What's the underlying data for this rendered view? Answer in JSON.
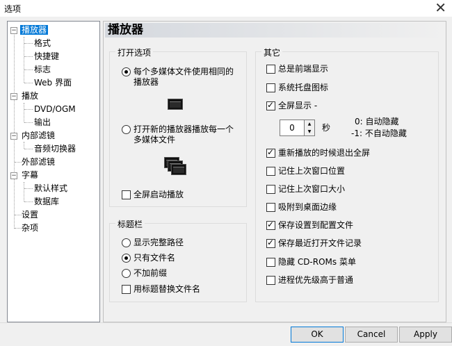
{
  "window": {
    "title": "选项",
    "close_glyph": "✕"
  },
  "tree": {
    "items": [
      {
        "label": "播放器"
      },
      {
        "label": "格式"
      },
      {
        "label": "快捷键"
      },
      {
        "label": "标志"
      },
      {
        "label": "Web 界面"
      },
      {
        "label": "播放"
      },
      {
        "label": "DVD/OGM"
      },
      {
        "label": "输出"
      },
      {
        "label": "内部滤镜"
      },
      {
        "label": "音频切换器"
      },
      {
        "label": "外部滤镜"
      },
      {
        "label": "字幕"
      },
      {
        "label": "默认样式"
      },
      {
        "label": "数据库"
      },
      {
        "label": "设置"
      },
      {
        "label": "杂项"
      }
    ]
  },
  "page": {
    "header": "播放器"
  },
  "open_options": {
    "title": "打开选项",
    "same_player": "每个多媒体文件使用相同的播放器",
    "new_player": "打开新的播放器播放每一个多媒体文件",
    "fullscreen_start": "全屏启动播放"
  },
  "title_bar": {
    "title": "标题栏",
    "full_path": "显示完整路径",
    "filename_only": "只有文件名",
    "no_prefix": "不加前缀",
    "replace_title": "用标题替换文件名"
  },
  "other": {
    "title": "其它",
    "on_top": "总是前端显示",
    "tray_icon": "系统托盘图标",
    "fullscreen": "全屏显示 -",
    "seconds_value": "0",
    "seconds_unit": "秒",
    "auto_hide": "0: 自动隐藏",
    "no_auto_hide": "-1: 不自动隐藏",
    "exit_fullscreen": "重新播放的时候退出全屏",
    "remember_pos": "记住上次窗口位置",
    "remember_size": "记住上次窗口大小",
    "snap_edges": "吸附到桌面边缘",
    "save_to_file": "保存设置到配置文件",
    "save_recent": "保存最近打开文件记录",
    "hide_cdroms": "隐藏 CD-ROMs 菜单",
    "high_priority": "进程优先级高于普通"
  },
  "buttons": {
    "ok": "OK",
    "cancel": "Cancel",
    "apply": "Apply"
  }
}
